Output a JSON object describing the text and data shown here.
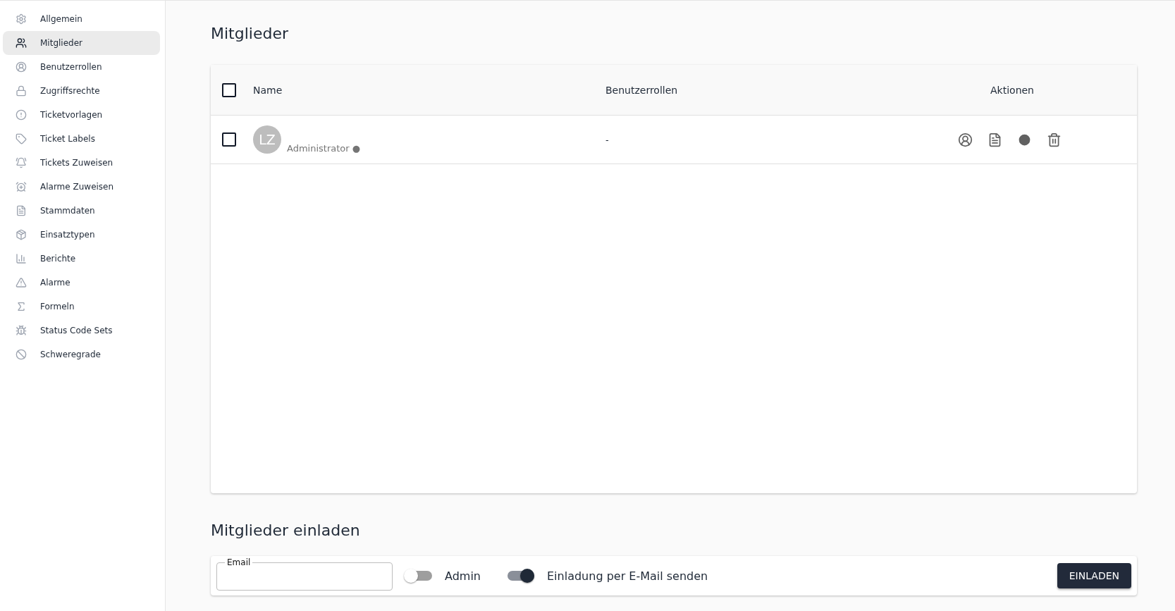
{
  "sidebar": {
    "items": [
      {
        "label": "Allgemein",
        "selected": false
      },
      {
        "label": "Mitglieder",
        "selected": true
      },
      {
        "label": "Benutzerrollen",
        "selected": false
      },
      {
        "label": "Zugriffsrechte",
        "selected": false
      },
      {
        "label": "Ticketvorlagen",
        "selected": false
      },
      {
        "label": "Ticket Labels",
        "selected": false
      },
      {
        "label": "Tickets Zuweisen",
        "selected": false
      },
      {
        "label": "Alarme Zuweisen",
        "selected": false
      },
      {
        "label": "Stammdaten",
        "selected": false
      },
      {
        "label": "Einsatztypen",
        "selected": false
      },
      {
        "label": "Berichte",
        "selected": false
      },
      {
        "label": "Alarme",
        "selected": false
      },
      {
        "label": "Formeln",
        "selected": false
      },
      {
        "label": "Status Code Sets",
        "selected": false
      },
      {
        "label": "Schweregrade",
        "selected": false
      }
    ]
  },
  "members": {
    "title": "Mitglieder",
    "columns": [
      "Name",
      "Benutzerrollen",
      "Aktionen"
    ],
    "all_checked": false,
    "rows": [
      {
        "initials": "LZ",
        "role": "Administrator ●",
        "roles": "-",
        "checked": false
      }
    ]
  },
  "invite": {
    "title": "Mitglieder einladen",
    "email_label": "Email",
    "admin": {
      "label": "Admin",
      "on": false
    },
    "send_mail": {
      "label": "Einladung per E-Mail senden",
      "on": true
    },
    "button": "EINLADEN"
  }
}
